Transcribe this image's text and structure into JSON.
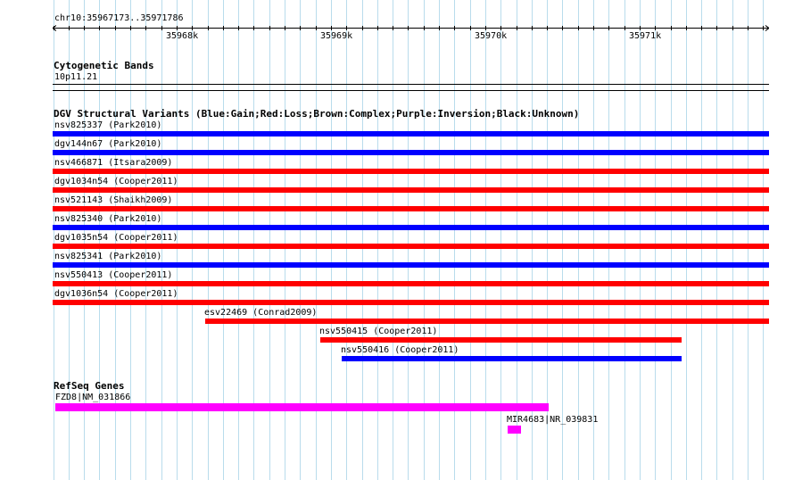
{
  "locus": "chr10:35967173..35971786",
  "ruler": {
    "ticks": [
      "35968k",
      "35969k",
      "35970k",
      "35971k"
    ]
  },
  "cytobands": {
    "title": "Cytogenetic Bands",
    "band": "10p11.21"
  },
  "dgv": {
    "title": "DGV Structural Variants (Blue:Gain;Red:Loss;Brown:Complex;Purple:Inversion;Black:Unknown)",
    "colors": {
      "gain": "#0000ff",
      "loss": "#ff0000",
      "complex": "#8b4513",
      "inversion": "#800080",
      "unknown": "#000000"
    },
    "variants": [
      {
        "label": "nsv825337 (Park2010)",
        "type": "gain"
      },
      {
        "label": "dgv144n67 (Park2010)",
        "type": "gain"
      },
      {
        "label": "nsv466871 (Itsara2009)",
        "type": "loss"
      },
      {
        "label": "dgv1034n54 (Cooper2011)",
        "type": "loss"
      },
      {
        "label": "nsv521143 (Shaikh2009)",
        "type": "loss"
      },
      {
        "label": "nsv825340 (Park2010)",
        "type": "gain"
      },
      {
        "label": "dgv1035n54 (Cooper2011)",
        "type": "loss"
      },
      {
        "label": "nsv825341 (Park2010)",
        "type": "gain"
      },
      {
        "label": "nsv550413 (Cooper2011)",
        "type": "loss"
      },
      {
        "label": "dgv1036n54 (Cooper2011)",
        "type": "loss"
      },
      {
        "label": "esv22469 (Conrad2009)",
        "type": "loss"
      },
      {
        "label": "nsv550415 (Cooper2011)",
        "type": "loss"
      },
      {
        "label": "nsv550416 (Cooper2011)",
        "type": "gain"
      }
    ]
  },
  "refseq": {
    "title": "RefSeq Genes",
    "color": "#ff00ff",
    "genes": [
      {
        "label": "FZD8|NM_031866"
      },
      {
        "label": "MIR4683|NR_039831"
      }
    ]
  }
}
